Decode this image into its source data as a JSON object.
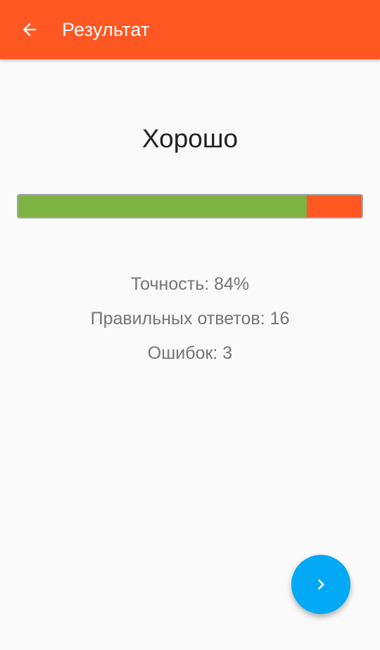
{
  "toolbar": {
    "title": "Результат",
    "back_icon": "arrow-back-icon",
    "background": "#ff5722"
  },
  "result": {
    "grade": "Хорошо",
    "progress": {
      "fraction_correct": 0.84,
      "correct_color": "#7cb342",
      "wrong_color": "#ff5722"
    },
    "accuracy": "Точность: 84%",
    "correct_answers": "Правильных ответов: 16",
    "errors": "Ошибок: 3"
  },
  "fab": {
    "icon": "chevron-right-icon",
    "color": "#03a9f4"
  }
}
